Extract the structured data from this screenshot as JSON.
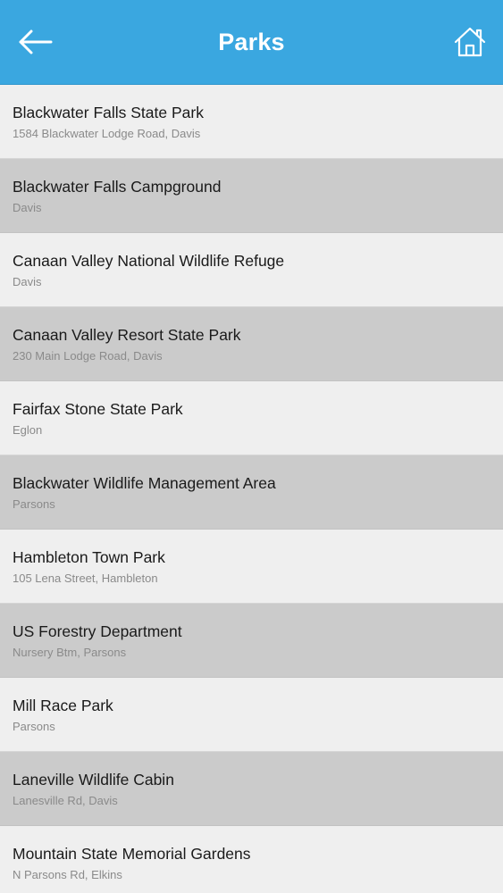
{
  "header": {
    "title": "Parks",
    "back_icon": "arrow-left-icon",
    "home_icon": "home-icon",
    "bg_color": "#3aa7e0"
  },
  "parks": [
    {
      "name": "Blackwater Falls State Park",
      "address": "1584 Blackwater Lodge Road, Davis"
    },
    {
      "name": "Blackwater Falls Campground",
      "address": "Davis"
    },
    {
      "name": "Canaan Valley National Wildlife Refuge",
      "address": "Davis"
    },
    {
      "name": "Canaan Valley Resort State Park",
      "address": "230 Main Lodge Road, Davis"
    },
    {
      "name": "Fairfax Stone State Park",
      "address": "Eglon"
    },
    {
      "name": "Blackwater Wildlife Management Area",
      "address": "Parsons"
    },
    {
      "name": "Hambleton Town Park",
      "address": "105 Lena Street, Hambleton"
    },
    {
      "name": "US Forestry Department",
      "address": "Nursery Btm, Parsons"
    },
    {
      "name": "Mill Race Park",
      "address": "Parsons"
    },
    {
      "name": "Laneville Wildlife Cabin",
      "address": "Lanesville Rd, Davis"
    },
    {
      "name": "Mountain State Memorial Gardens",
      "address": "N Parsons Rd, Elkins"
    }
  ]
}
